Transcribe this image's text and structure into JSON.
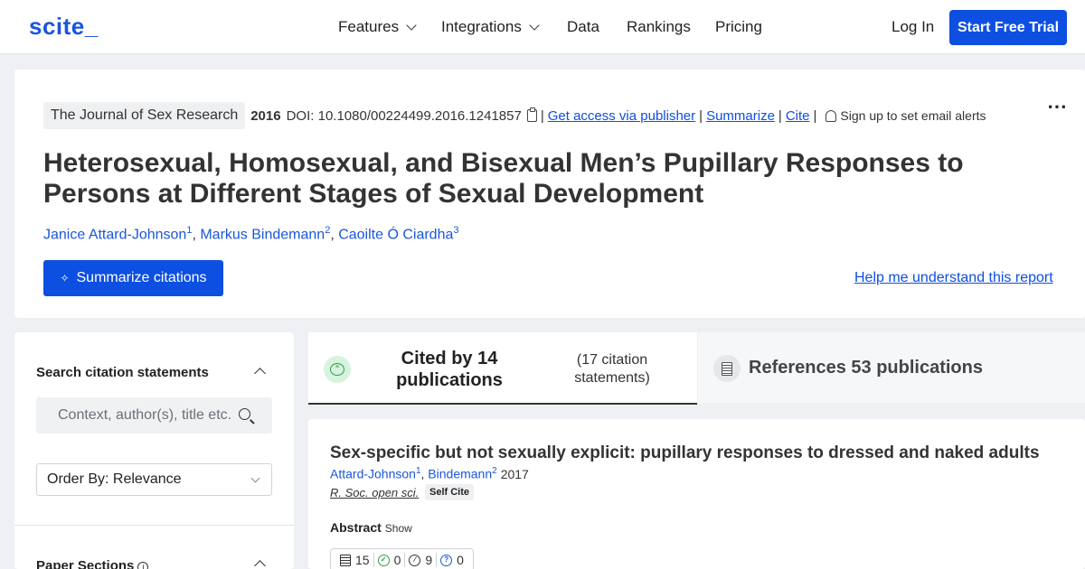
{
  "nav": {
    "logo": "scite_",
    "links": [
      "Features",
      "Integrations",
      "Data",
      "Rankings",
      "Pricing"
    ],
    "login": "Log In",
    "cta": "Start Free Trial"
  },
  "paper": {
    "journal": "The Journal of Sex Research",
    "year": "2016",
    "doi": "DOI: 10.1080/00224499.2016.1241857",
    "actions": {
      "access": "Get access via publisher",
      "summarize": "Summarize",
      "cite": "Cite",
      "alerts": "Sign up to set email alerts"
    },
    "title": "Heterosexual, Homosexual, and Bisexual Men’s Pupillary Responses to Persons at Different Stages of Sexual Development",
    "authors": [
      {
        "name": "Janice Attard-Johnson",
        "sup": "1"
      },
      {
        "name": "Markus Bindemann",
        "sup": "2"
      },
      {
        "name": "Caoilte Ó Ciardha",
        "sup": "3"
      }
    ],
    "summarize_button": "Summarize citations",
    "help_link": "Help me understand this report"
  },
  "sidebar": {
    "search_title": "Search citation statements",
    "search_placeholder": "Context, author(s), title etc.",
    "order_by": "Order By: Relevance",
    "sections_title": "Paper Sections"
  },
  "tabs": {
    "cited_by": "Cited by 14 publications",
    "citation_statements": "(17 citation statements)",
    "references": "References 53 publications"
  },
  "citation": {
    "title": "Sex-specific but not sexually explicit: pupillary responses to dressed and naked adults",
    "authors": [
      {
        "name": "Attard-Johnson",
        "sup": "1"
      },
      {
        "name": "Bindemann",
        "sup": "2"
      }
    ],
    "year": "2017",
    "journal": "R. Soc. open sci.",
    "badge": "Self Cite",
    "abstract_label": "Abstract",
    "show_label": "Show",
    "stats": {
      "mentioning": "15",
      "supporting": "0",
      "contrasting": "9",
      "unclassified": "0"
    }
  },
  "colors": {
    "brand": "#1a56db",
    "button": "#0d4fe0",
    "supporting": "#2e9e4a",
    "question": "#1a56db"
  }
}
